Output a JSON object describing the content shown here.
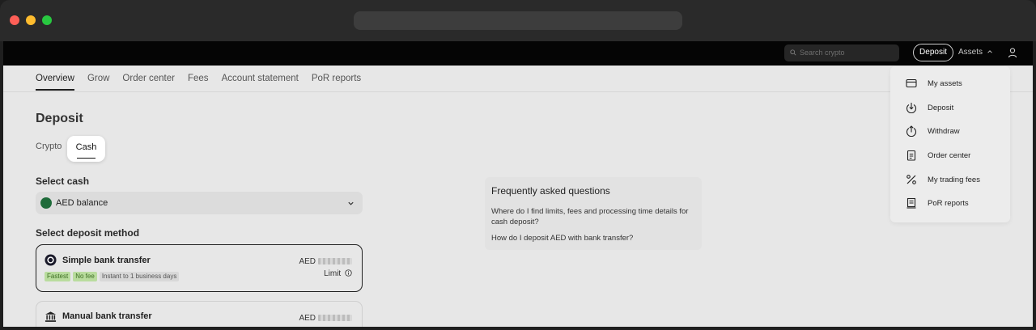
{
  "topnav": {
    "search_placeholder": "Search crypto",
    "deposit_label": "Deposit",
    "assets_label": "Assets"
  },
  "tabs": [
    "Overview",
    "Grow",
    "Order center",
    "Fees",
    "Account statement",
    "PoR reports"
  ],
  "page": {
    "title": "Deposit",
    "segment_crypto": "Crypto",
    "segment_cash": "Cash"
  },
  "select_cash": {
    "label": "Select cash",
    "value": "AED balance"
  },
  "deposit_method": {
    "label": "Select deposit method",
    "methods": [
      {
        "name": "Simple bank transfer",
        "currency": "AED",
        "tags": [
          "Fastest",
          "No fee",
          "Instant to 1 business days"
        ],
        "limit_label": "Limit"
      },
      {
        "name": "Manual bank transfer",
        "currency": "AED"
      }
    ]
  },
  "faq": {
    "title": "Frequently asked questions",
    "questions": [
      "Where do I find limits, fees and processing time details for cash deposit?",
      "How do I deposit AED with bank transfer?"
    ]
  },
  "assets_menu": {
    "items": [
      {
        "label": "My assets",
        "icon": "card-icon"
      },
      {
        "label": "Deposit",
        "icon": "deposit-arrow-icon"
      },
      {
        "label": "Withdraw",
        "icon": "withdraw-arrow-icon"
      },
      {
        "label": "Order center",
        "icon": "clipboard-icon"
      },
      {
        "label": "My trading fees",
        "icon": "percent-icon"
      },
      {
        "label": "PoR reports",
        "icon": "report-icon"
      }
    ]
  },
  "colors": {
    "accent_green_tag": "#b9dc9e",
    "top_bar": "#050505",
    "page_bg": "#e7e7e7"
  }
}
